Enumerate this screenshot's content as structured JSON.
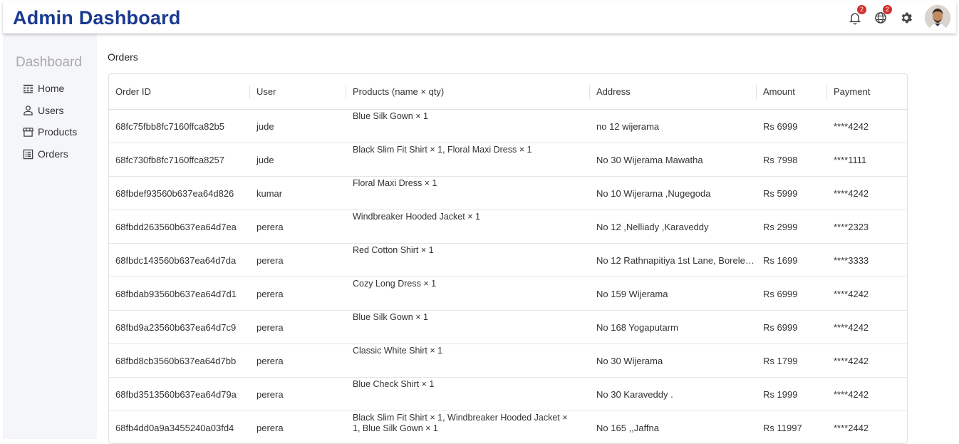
{
  "app": {
    "title": "Admin Dashboard"
  },
  "header": {
    "notifications_badge": "2",
    "language_badge": "2",
    "icons": [
      "bell-icon",
      "globe-icon",
      "gear-icon",
      "avatar"
    ]
  },
  "sidebar": {
    "title": "Dashboard",
    "items": [
      {
        "label": "Home",
        "icon": "home-icon"
      },
      {
        "label": "Users",
        "icon": "user-icon"
      },
      {
        "label": "Products",
        "icon": "store-icon"
      },
      {
        "label": "Orders",
        "icon": "list-icon"
      }
    ]
  },
  "page": {
    "title": "Orders"
  },
  "table": {
    "columns": [
      "Order ID",
      "User",
      "Products (name × qty)",
      "Address",
      "Amount",
      "Payment"
    ],
    "rows": [
      {
        "id": "68fc75fbb8fc7160ffca82b5",
        "user": "jude",
        "products": "Blue Silk Gown × 1",
        "address": "no 12 wijerama",
        "amount": "Rs 6999",
        "payment": "****4242"
      },
      {
        "id": "68fc730fb8fc7160ffca8257",
        "user": "jude",
        "products": "Black Slim Fit Shirt × 1, Floral Maxi Dress × 1",
        "address": "No 30 Wijerama Mawatha",
        "amount": "Rs 7998",
        "payment": "****1111"
      },
      {
        "id": "68fbdef93560b637ea64d826",
        "user": "kumar",
        "products": "Floral Maxi Dress × 1",
        "address": "No 10 Wijerama ,Nugegoda",
        "amount": "Rs 5999",
        "payment": "****4242"
      },
      {
        "id": "68fbdd263560b637ea64d7ea",
        "user": "perera",
        "products": "Windbreaker Hooded Jacket × 1",
        "address": "No 12 ,Nelliady ,Karaveddy",
        "amount": "Rs 2999",
        "payment": "****2323"
      },
      {
        "id": "68fbdc143560b637ea64d7da",
        "user": "perera",
        "products": "Red Cotton Shirt × 1",
        "address": "No 12 Rathnapitiya 1st Lane, Boreles…",
        "amount": "Rs 1699",
        "payment": "****3333"
      },
      {
        "id": "68fbdab93560b637ea64d7d1",
        "user": "perera",
        "products": "Cozy Long Dress × 1",
        "address": "No 159 Wijerama",
        "amount": "Rs 6999",
        "payment": "****4242"
      },
      {
        "id": "68fbd9a23560b637ea64d7c9",
        "user": "perera",
        "products": "Blue Silk Gown × 1",
        "address": "No 168 Yogaputarm",
        "amount": "Rs 6999",
        "payment": "****4242"
      },
      {
        "id": "68fbd8cb3560b637ea64d7bb",
        "user": "perera",
        "products": "Classic White Shirt × 1",
        "address": "No 30 Wijerama",
        "amount": "Rs 1799",
        "payment": "****4242"
      },
      {
        "id": "68fbd3513560b637ea64d79a",
        "user": "perera",
        "products": "Blue Check Shirt × 1",
        "address": "No 30 Karaveddy .",
        "amount": "Rs 1999",
        "payment": "****4242"
      },
      {
        "id": "68fb4dd0a9a3455240a03fd4",
        "user": "perera",
        "products": "Black Slim Fit Shirt × 1, Windbreaker Hooded Jacket × 1, Blue Silk Gown × 1",
        "address": "No 165 ,,Jaffna",
        "amount": "Rs 11997",
        "payment": "****2442"
      }
    ]
  }
}
